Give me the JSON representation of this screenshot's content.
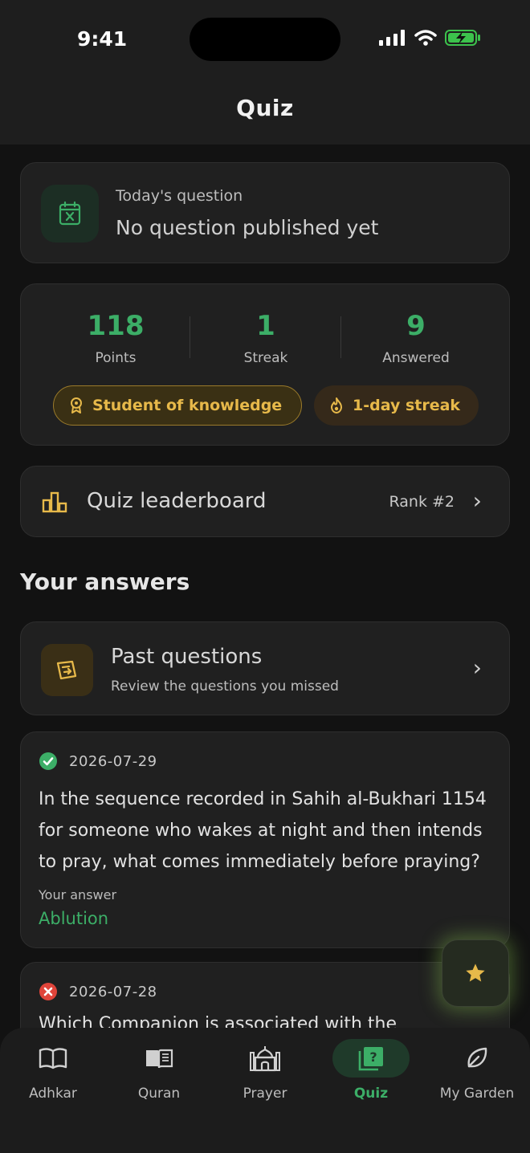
{
  "status": {
    "time": "9:41"
  },
  "header": {
    "title": "Quiz"
  },
  "today": {
    "label": "Today's question",
    "value": "No question published yet"
  },
  "stats": {
    "points": {
      "value": "118",
      "label": "Points"
    },
    "streak": {
      "value": "1",
      "label": "Streak"
    },
    "answered": {
      "value": "9",
      "label": "Answered"
    },
    "badges": [
      {
        "label": "Student of knowledge",
        "icon": "award-icon"
      },
      {
        "label": "1-day streak",
        "icon": "flame-icon"
      }
    ]
  },
  "leaderboard": {
    "label": "Quiz leaderboard",
    "rank": "Rank #2"
  },
  "section": {
    "title": "Your answers"
  },
  "past": {
    "title": "Past questions",
    "subtitle": "Review the questions you missed"
  },
  "answers": [
    {
      "status": "correct",
      "date": "2026-07-29",
      "question": "In the sequence recorded in Sahih al-Bukhari 1154 for someone who wakes at night and then intends to pray, what comes immediately before praying?",
      "answer_label": "Your answer",
      "answer": "Ablution"
    },
    {
      "status": "incorrect",
      "date": "2026-07-28",
      "question": "Which Companion is associated with the"
    }
  ],
  "tabs": [
    {
      "label": "Adhkar",
      "icon": "open-book-icon"
    },
    {
      "label": "Quran",
      "icon": "quran-icon"
    },
    {
      "label": "Prayer",
      "icon": "mosque-icon"
    },
    {
      "label": "Quiz",
      "icon": "quiz-icon",
      "active": true
    },
    {
      "label": "My Garden",
      "icon": "leaf-icon"
    }
  ],
  "colors": {
    "accent_green": "#3cae67",
    "accent_gold": "#e7b94a",
    "error_red": "#e0443a"
  }
}
